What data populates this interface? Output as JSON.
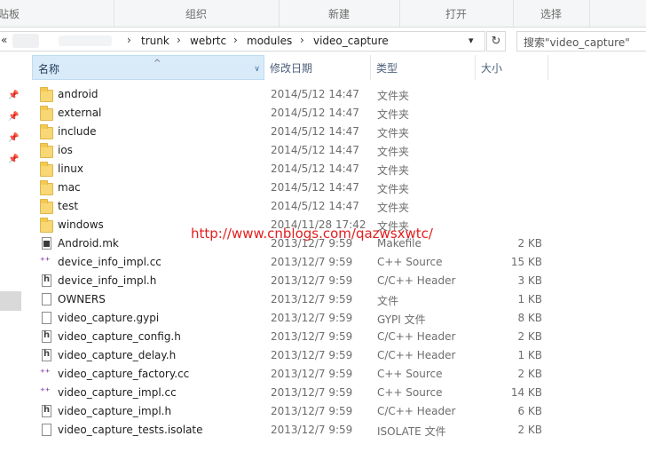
{
  "ribbon": {
    "groups": [
      "剪贴板",
      "组织",
      "新建",
      "打开",
      "选择"
    ],
    "clipboard_partial": "贴板"
  },
  "address_bar": {
    "back_glyph": "«",
    "crumbs": [
      "trunk",
      "webrtc",
      "modules",
      "video_capture"
    ]
  },
  "search": {
    "placeholder": "搜索\"video_capture\""
  },
  "columns": {
    "name": "名称",
    "date": "修改日期",
    "type": "类型",
    "size": "大小"
  },
  "files": [
    {
      "name": "android",
      "date": "2014/5/12 14:47",
      "type": "文件夹",
      "size": "",
      "icon": "folder-icon"
    },
    {
      "name": "external",
      "date": "2014/5/12 14:47",
      "type": "文件夹",
      "size": "",
      "icon": "folder-icon"
    },
    {
      "name": "include",
      "date": "2014/5/12 14:47",
      "type": "文件夹",
      "size": "",
      "icon": "folder-icon"
    },
    {
      "name": "ios",
      "date": "2014/5/12 14:47",
      "type": "文件夹",
      "size": "",
      "icon": "folder-icon"
    },
    {
      "name": "linux",
      "date": "2014/5/12 14:47",
      "type": "文件夹",
      "size": "",
      "icon": "folder-icon"
    },
    {
      "name": "mac",
      "date": "2014/5/12 14:47",
      "type": "文件夹",
      "size": "",
      "icon": "folder-icon"
    },
    {
      "name": "test",
      "date": "2014/5/12 14:47",
      "type": "文件夹",
      "size": "",
      "icon": "folder-icon"
    },
    {
      "name": "windows",
      "date": "2014/11/28 17:42",
      "type": "文件夹",
      "size": "",
      "icon": "folder-icon"
    },
    {
      "name": "Android.mk",
      "date": "2013/12/7 9:59",
      "type": "Makefile",
      "size": "2 KB",
      "icon": "makefile-icon"
    },
    {
      "name": "device_info_impl.cc",
      "date": "2013/12/7 9:59",
      "type": "C++ Source",
      "size": "15 KB",
      "icon": "cpp-source-icon"
    },
    {
      "name": "device_info_impl.h",
      "date": "2013/12/7 9:59",
      "type": "C/C++ Header",
      "size": "3 KB",
      "icon": "header-file-icon"
    },
    {
      "name": "OWNERS",
      "date": "2013/12/7 9:59",
      "type": "文件",
      "size": "1 KB",
      "icon": "file-icon"
    },
    {
      "name": "video_capture.gypi",
      "date": "2013/12/7 9:59",
      "type": "GYPI 文件",
      "size": "8 KB",
      "icon": "file-icon"
    },
    {
      "name": "video_capture_config.h",
      "date": "2013/12/7 9:59",
      "type": "C/C++ Header",
      "size": "2 KB",
      "icon": "header-file-icon"
    },
    {
      "name": "video_capture_delay.h",
      "date": "2013/12/7 9:59",
      "type": "C/C++ Header",
      "size": "1 KB",
      "icon": "header-file-icon"
    },
    {
      "name": "video_capture_factory.cc",
      "date": "2013/12/7 9:59",
      "type": "C++ Source",
      "size": "2 KB",
      "icon": "cpp-source-icon"
    },
    {
      "name": "video_capture_impl.cc",
      "date": "2013/12/7 9:59",
      "type": "C++ Source",
      "size": "14 KB",
      "icon": "cpp-source-icon"
    },
    {
      "name": "video_capture_impl.h",
      "date": "2013/12/7 9:59",
      "type": "C/C++ Header",
      "size": "6 KB",
      "icon": "header-file-icon"
    },
    {
      "name": "video_capture_tests.isolate",
      "date": "2013/12/7 9:59",
      "type": "ISOLATE 文件",
      "size": "2 KB",
      "icon": "file-icon"
    }
  ],
  "watermark": "http://www.cnblogs.com/qazwsxwtc/",
  "colors": {
    "accent_header": "#d9ebf9",
    "folder": "#f8d775",
    "watermark": "#e21e1e"
  }
}
